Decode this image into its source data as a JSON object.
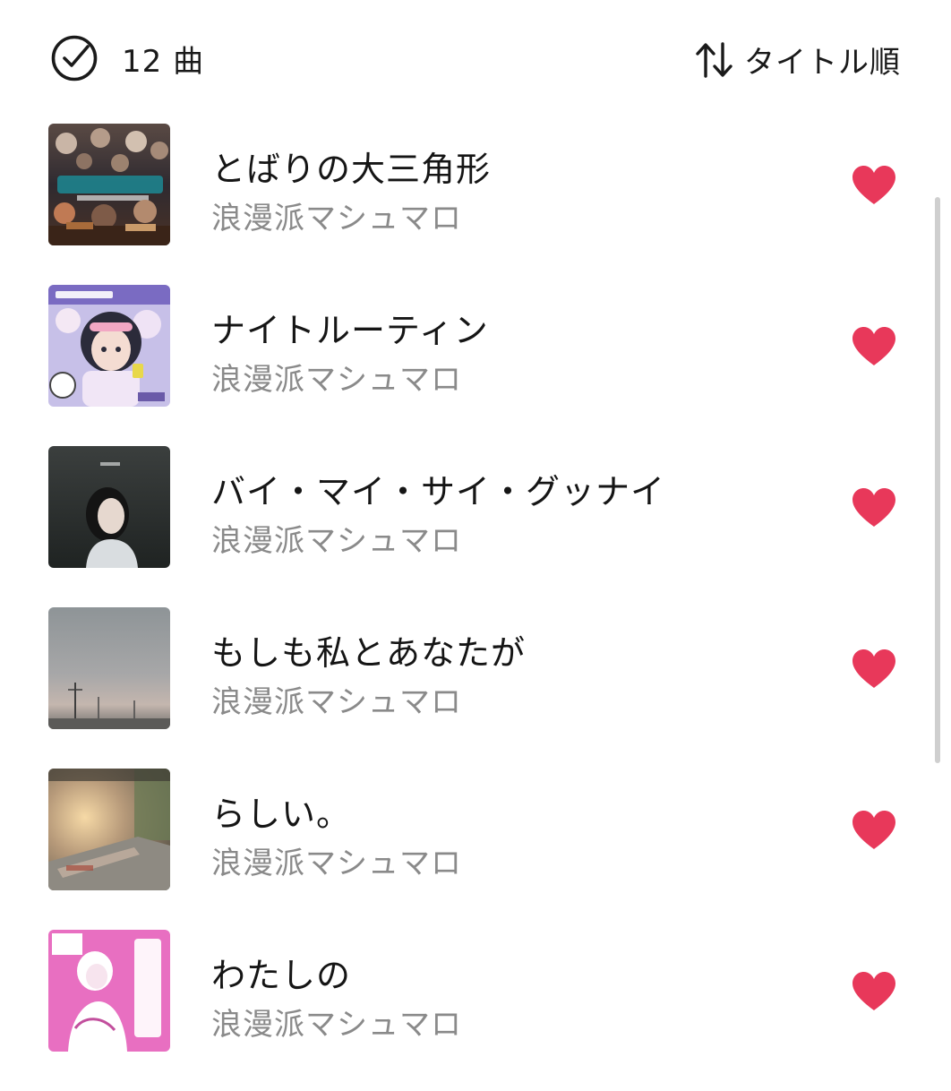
{
  "header": {
    "count_label": "12 曲",
    "sort_label": "タイトル順",
    "select_icon": "check-circle-icon",
    "sort_icon": "sort-arrows-icon"
  },
  "songs": [
    {
      "title": "とばりの大三角形",
      "artist": "浪漫派マシュマロ",
      "liked": true
    },
    {
      "title": "ナイトルーティン",
      "artist": "浪漫派マシュマロ",
      "liked": true
    },
    {
      "title": "バイ・マイ・サイ・グッナイ",
      "artist": "浪漫派マシュマロ",
      "liked": true
    },
    {
      "title": "もしも私とあなたが",
      "artist": "浪漫派マシュマロ",
      "liked": true
    },
    {
      "title": "らしい。",
      "artist": "浪漫派マシュマロ",
      "liked": true
    },
    {
      "title": "わたしの",
      "artist": "浪漫派マシュマロ",
      "liked": true
    }
  ],
  "colors": {
    "heart": "#e8385a",
    "text_primary": "#151515",
    "text_secondary": "#8a8a8a"
  }
}
